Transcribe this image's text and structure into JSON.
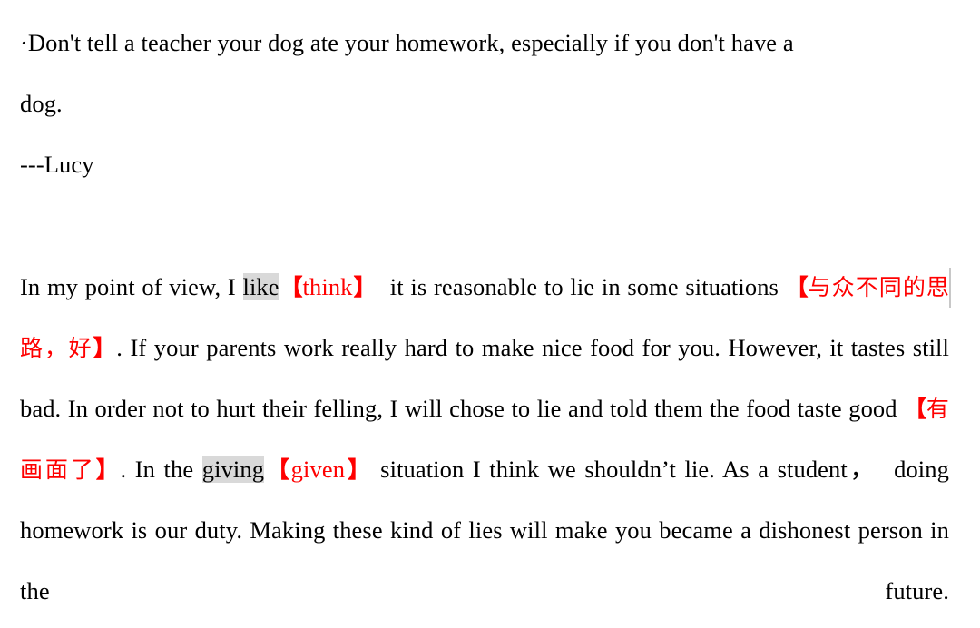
{
  "document": {
    "colors": {
      "text": "#000000",
      "correction_red": "#ff0000",
      "highlight_gray": "#d9d9d9",
      "caret_gray": "#c8c8c8",
      "page_background": "#ffffff"
    },
    "quote": {
      "line1": "·Don't tell a teacher your dog ate your homework, especially if you don't have a",
      "line2": "dog.",
      "attribution": "---Lucy"
    },
    "essay": {
      "seg1": "In my point of view, I ",
      "error1": "like",
      "correction1_open": "【",
      "correction1_text": "think",
      "correction1_close": "】",
      "seg2": "  it is reasonable to lie in some situations ",
      "comment1_open": "【",
      "comment1_text": "与众不同的思路，好",
      "comment1_close": "】",
      "seg3": ". If your parents work really hard to make nice food for you. However, it tastes still bad. In order not to hurt their felling, I will chose to lie and told them the food taste good ",
      "comment2_open": "【",
      "comment2_text": "有画面了",
      "comment2_close": "】",
      "seg4": ". In the ",
      "error2": "giving",
      "correction2_open": "【",
      "correction2_text": "given",
      "correction2_close": "】",
      "seg5": " situation I think we shouldn’t lie. As a student，",
      "seg6": "  doing homework is our duty. Making these kind of lies will make you became a dishonest person in the future."
    }
  }
}
